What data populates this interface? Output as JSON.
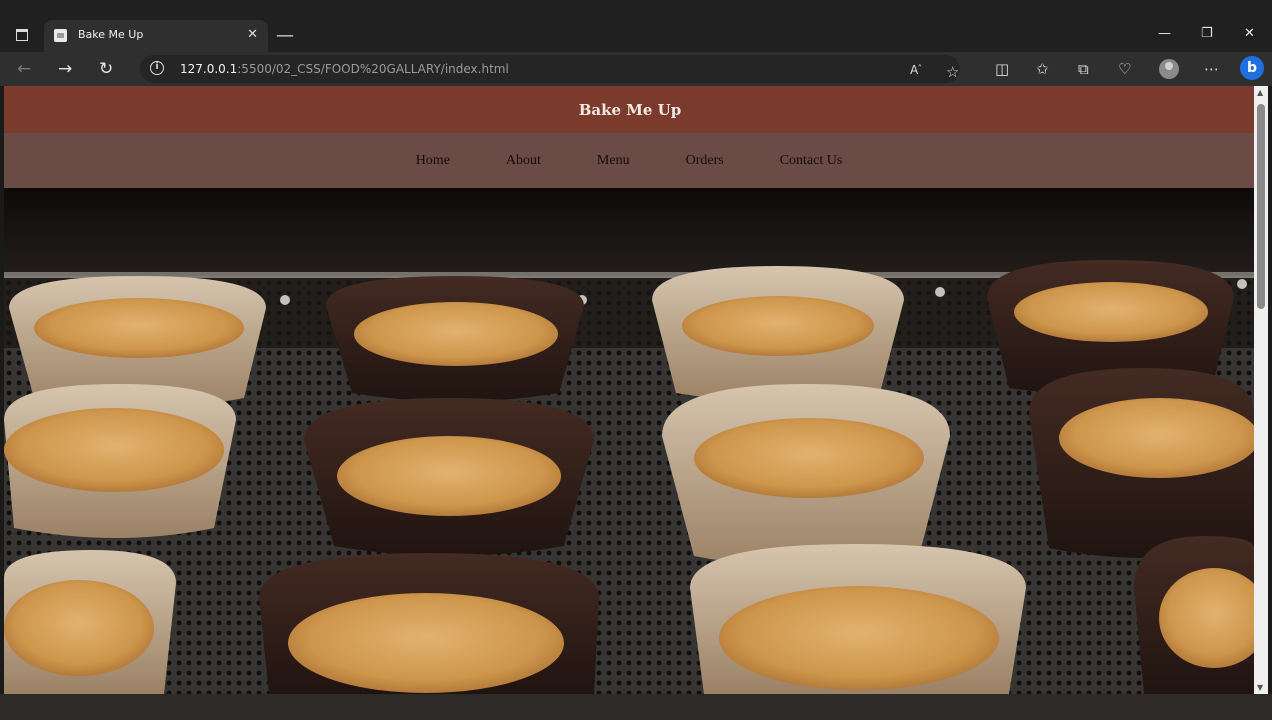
{
  "browser": {
    "tab_title": "Bake Me Up",
    "tab_close": "✕",
    "new_tab": "—",
    "url_host": "127.0.0.1",
    "url_path": ":5500/02_CSS/FOOD%20GALLARY/index.html",
    "window_controls": {
      "minimize": "—",
      "restore": "❐",
      "close": "✕"
    }
  },
  "site": {
    "title": "Bake Me Up",
    "nav": [
      "Home",
      "About",
      "Menu",
      "Orders",
      "Contact Us"
    ]
  },
  "colors": {
    "header_bg": "#7a3a2c",
    "nav_bg": "#6b4b46",
    "browser_bg": "#202020"
  }
}
